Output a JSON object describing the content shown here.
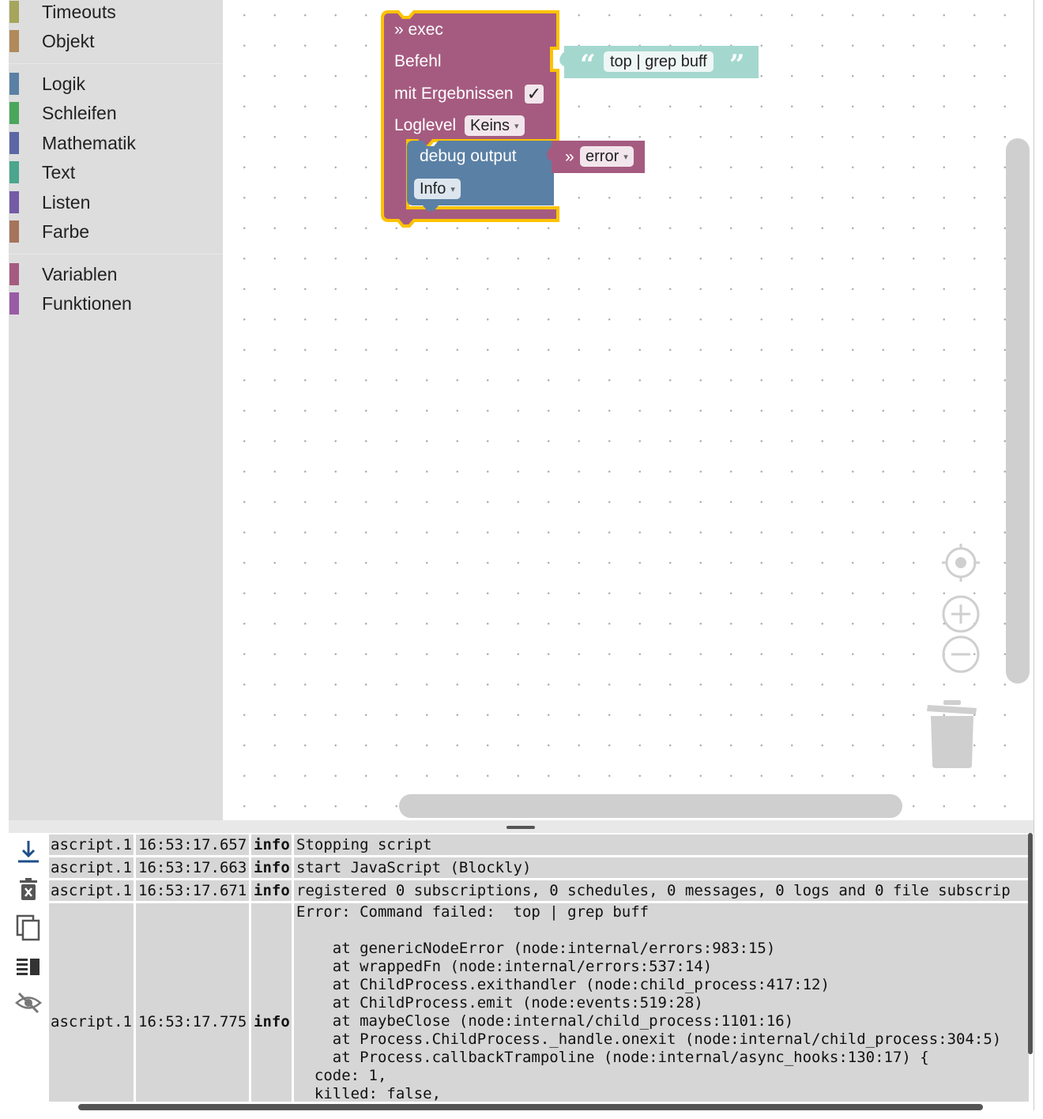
{
  "sidebar": {
    "categories_top": [
      {
        "label": "Timeouts",
        "color": "#a5a55b"
      },
      {
        "label": "Objekt",
        "color": "#b08a5a"
      }
    ],
    "categories_mid": [
      {
        "label": "Logik",
        "color": "#5b80a5"
      },
      {
        "label": "Schleifen",
        "color": "#4aa65b"
      },
      {
        "label": "Mathematik",
        "color": "#5b67a5"
      },
      {
        "label": "Text",
        "color": "#4ca58d"
      },
      {
        "label": "Listen",
        "color": "#745ba5"
      },
      {
        "label": "Farbe",
        "color": "#a5745b"
      }
    ],
    "categories_bottom": [
      {
        "label": "Variablen",
        "color": "#a55b80"
      },
      {
        "label": "Funktionen",
        "color": "#995ba5"
      }
    ]
  },
  "blocks": {
    "exec": {
      "title": "» exec",
      "command_label": "Befehl",
      "results_label": "mit Ergebnissen",
      "results_checked": "✓",
      "loglevel_label": "Loglevel",
      "loglevel_value": "Keins",
      "color": "#a55b80"
    },
    "text": {
      "open_quote": "“",
      "value": "top | grep buff",
      "close_quote": "”",
      "color": "#a4d8cf"
    },
    "debug": {
      "label": "debug output",
      "level": "Info",
      "color": "#5b80a5"
    },
    "error_var": {
      "prefix": "»",
      "value": "error",
      "color": "#a55b80"
    }
  },
  "log": {
    "rows": [
      {
        "source": "ascript.1",
        "time": "16:53:17.657",
        "level": "info",
        "message": "Stopping script"
      },
      {
        "source": "ascript.1",
        "time": "16:53:17.663",
        "level": "info",
        "message": "start JavaScript (Blockly)"
      },
      {
        "source": "ascript.1",
        "time": "16:53:17.671",
        "level": "info",
        "message": "registered 0 subscriptions, 0 schedules, 0 messages, 0 logs and 0 file subscrip"
      },
      {
        "source": "ascript.1",
        "time": "16:53:17.775",
        "level": "info",
        "message": "Error: Command failed:  top | grep buff\n\n    at genericNodeError (node:internal/errors:983:15)\n    at wrappedFn (node:internal/errors:537:14)\n    at ChildProcess.exithandler (node:child_process:417:12)\n    at ChildProcess.emit (node:events:519:28)\n    at maybeClose (node:internal/child_process:1101:16)\n    at Process.ChildProcess._handle.onexit (node:internal/child_process:304:5)\n    at Process.callbackTrampoline (node:internal/async_hooks:130:17) {\n  code: 1,\n  killed: false,"
      }
    ]
  }
}
